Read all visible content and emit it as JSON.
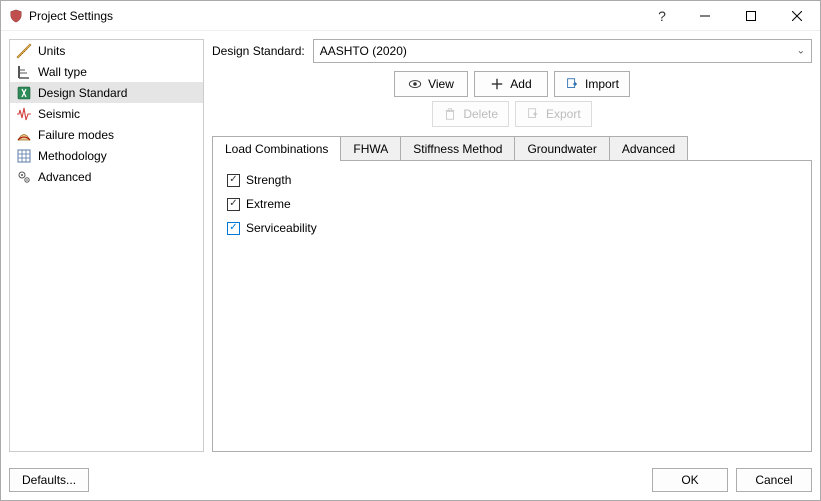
{
  "window": {
    "title": "Project Settings"
  },
  "sidebar": {
    "items": [
      {
        "label": "Units"
      },
      {
        "label": "Wall type"
      },
      {
        "label": "Design Standard"
      },
      {
        "label": "Seismic"
      },
      {
        "label": "Failure modes"
      },
      {
        "label": "Methodology"
      },
      {
        "label": "Advanced"
      }
    ],
    "selected_index": 2
  },
  "main": {
    "standard_label": "Design Standard:",
    "standard_value": "AASHTO (2020)",
    "buttons": {
      "view": "View",
      "add": "Add",
      "import": "Import",
      "delete": "Delete",
      "export": "Export"
    },
    "tabs": [
      {
        "label": "Load Combinations"
      },
      {
        "label": "FHWA"
      },
      {
        "label": "Stiffness Method"
      },
      {
        "label": "Groundwater"
      },
      {
        "label": "Advanced"
      }
    ],
    "active_tab": 0,
    "load_combinations": [
      {
        "label": "Strength",
        "checked": true
      },
      {
        "label": "Extreme",
        "checked": true
      },
      {
        "label": "Serviceability",
        "checked": true
      }
    ]
  },
  "footer": {
    "defaults": "Defaults...",
    "ok": "OK",
    "cancel": "Cancel"
  }
}
